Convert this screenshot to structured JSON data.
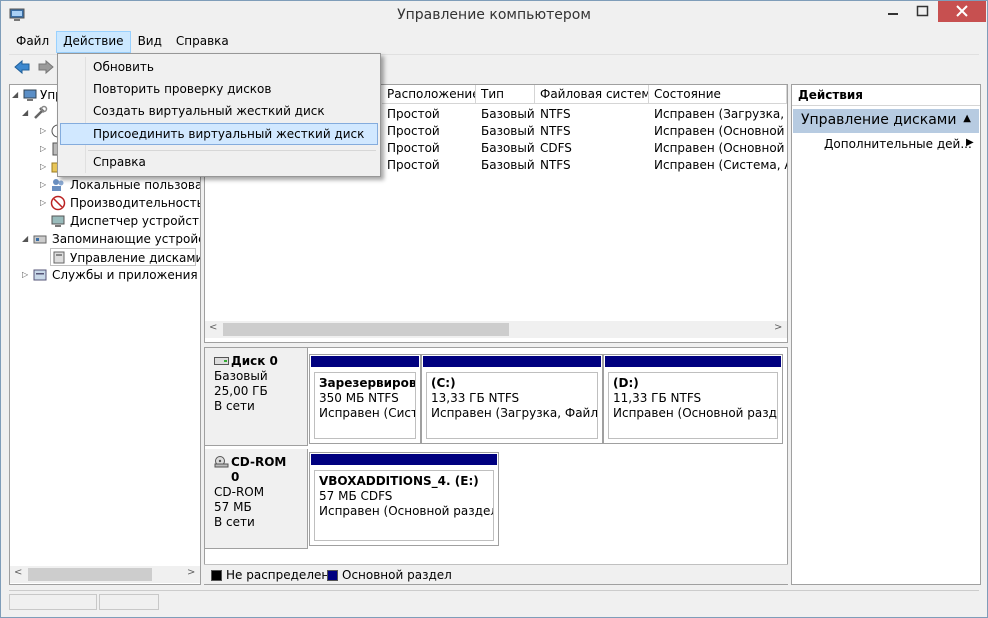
{
  "window": {
    "title": "Управление компьютером"
  },
  "menubar": {
    "items": [
      "Файл",
      "Действие",
      "Вид",
      "Справка"
    ]
  },
  "dropdown": {
    "items": [
      "Обновить",
      "Повторить проверку дисков",
      "Создать виртуальный жесткий диск",
      "Присоединить виртуальный жесткий диск"
    ],
    "help": "Справка"
  },
  "tree": {
    "root": "Упра",
    "local_users": "Локальные пользовате",
    "performance": "Производительность",
    "device_manager": "Диспетчер устройств",
    "storage": "Запоминающие устройст",
    "disk_management": "Управление дисками",
    "services": "Службы и приложения"
  },
  "volume_table": {
    "headers": [
      "Расположение",
      "Тип",
      "Файловая система",
      "Состояние"
    ],
    "rows": [
      [
        "Простой",
        "Базовый",
        "NTFS",
        "Исправен (Загрузка, Фа"
      ],
      [
        "Простой",
        "Базовый",
        "NTFS",
        "Исправен (Основной ра"
      ],
      [
        "Простой",
        "Базовый",
        "CDFS",
        "Исправен (Основной ра"
      ],
      [
        "Простой",
        "Базовый",
        "NTFS",
        "Исправен (Система, Акт"
      ]
    ]
  },
  "disks": [
    {
      "name": "Диск 0",
      "type": "Базовый",
      "size": "25,00 ГБ",
      "status": "В сети",
      "partitions": [
        {
          "name": "Зарезервирован",
          "size": "350 МБ NTFS",
          "status": "Исправен (Систем"
        },
        {
          "name": "(C:)",
          "size": "13,33 ГБ NTFS",
          "status": "Исправен (Загрузка, Файл под"
        },
        {
          "name": "(D:)",
          "size": "11,33 ГБ NTFS",
          "status": "Исправен (Основной раздел)"
        }
      ]
    },
    {
      "name": "CD-ROM 0",
      "type": "CD-ROM",
      "size": "57 МБ",
      "status": "В сети",
      "partitions": [
        {
          "name": "VBOXADDITIONS_4.  (E:)",
          "size": "57 МБ CDFS",
          "status": "Исправен (Основной раздел)"
        }
      ]
    }
  ],
  "legend": {
    "unallocated": "Не распределена",
    "primary": "Основной раздел"
  },
  "actions": {
    "title": "Действия",
    "section": "Управление дисками",
    "more": "Дополнительные дей..."
  },
  "colors": {
    "partition_bar": "#00007f",
    "menu_highlight": "#d1e8ff",
    "actions_header": "#b7cbe1",
    "close_button": "#c75050"
  }
}
